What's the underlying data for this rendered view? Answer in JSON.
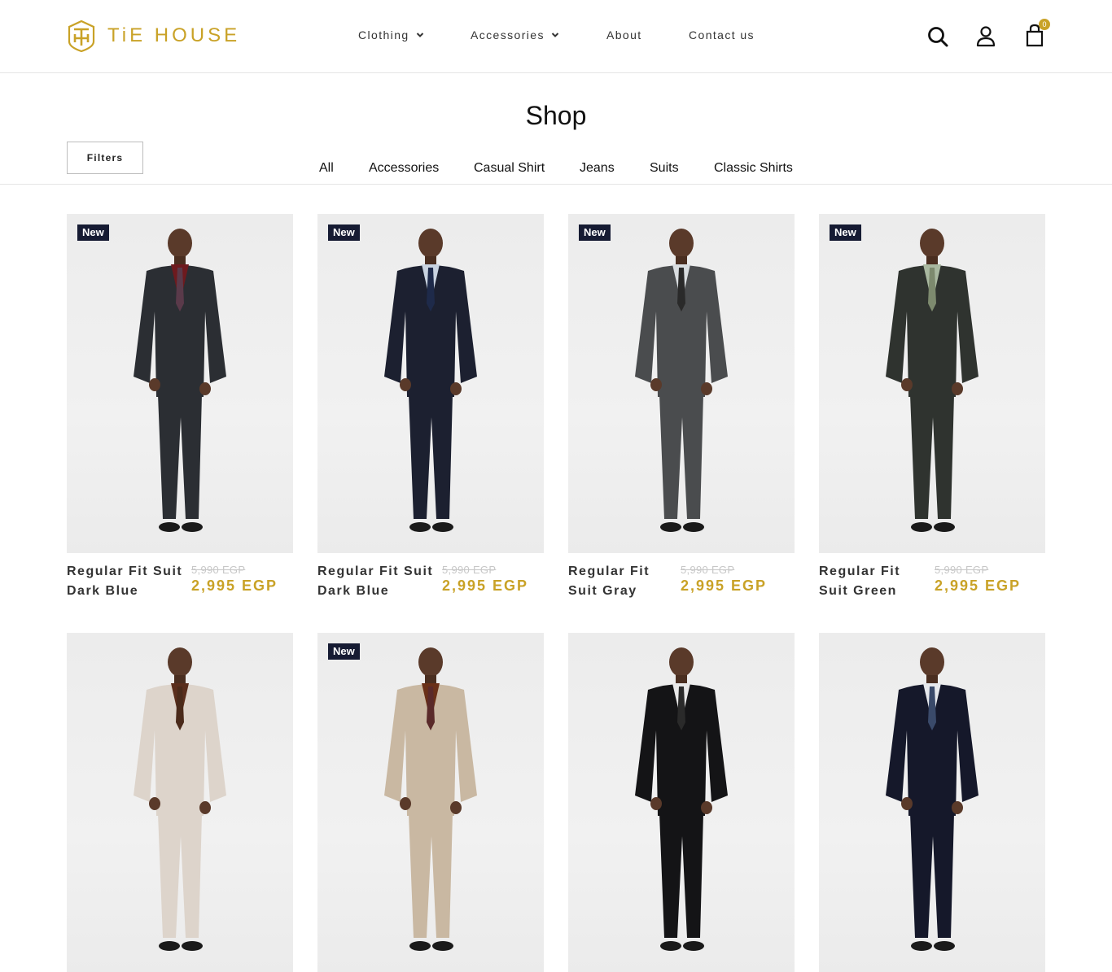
{
  "brand": {
    "name": "TiE HOUSE",
    "accent_color": "#c9a227"
  },
  "nav": {
    "items": [
      {
        "label": "Clothing",
        "has_dropdown": true
      },
      {
        "label": "Accessories",
        "has_dropdown": true
      },
      {
        "label": "About",
        "has_dropdown": false
      },
      {
        "label": "Contact us",
        "has_dropdown": false
      }
    ]
  },
  "header_icons": {
    "search": "search-icon",
    "account": "user-icon",
    "cart": "shopping-bag-icon",
    "cart_count": "0"
  },
  "shop": {
    "title": "Shop",
    "filters_label": "Filters",
    "categories": [
      "All",
      "Accessories",
      "Casual Shirt",
      "Jeans",
      "Suits",
      "Classic Shirts"
    ]
  },
  "products": [
    {
      "badge": "New",
      "name_line1": "Regular Fit Suit",
      "name_line2": "Dark Blue",
      "old_price": "5,990 EGP",
      "price": "2,995 EGP",
      "suit_color": "#2b2e33",
      "shirt_color": "#6e1a1e",
      "tie_color": "#5a3a4a"
    },
    {
      "badge": "New",
      "name_line1": "Regular Fit Suit",
      "name_line2": "Dark Blue",
      "old_price": "5,990 EGP",
      "price": "2,995 EGP",
      "suit_color": "#1c2030",
      "shirt_color": "#c9d3e0",
      "tie_color": "#1e2a4a"
    },
    {
      "badge": "New",
      "name_line1": "Regular Fit",
      "name_line2": "Suit Gray",
      "old_price": "5,990 EGP",
      "price": "2,995 EGP",
      "suit_color": "#4a4c4e",
      "shirt_color": "#d9dde0",
      "tie_color": "#2a2a2a"
    },
    {
      "badge": "New",
      "name_line1": "Regular Fit",
      "name_line2": "Suit Green",
      "old_price": "5,990 EGP",
      "price": "2,995 EGP",
      "suit_color": "#2f332f",
      "shirt_color": "#a9b8a0",
      "tie_color": "#7d8a6e"
    },
    {
      "badge": "",
      "name_line1": "",
      "name_line2": "",
      "old_price": "",
      "price": "",
      "suit_color": "#ddd4cb",
      "shirt_color": "#5a2e1c",
      "tie_color": "#4a2a1a"
    },
    {
      "badge": "New",
      "name_line1": "",
      "name_line2": "",
      "old_price": "",
      "price": "",
      "suit_color": "#c9b8a2",
      "shirt_color": "#6a3018",
      "tie_color": "#5a2a2a"
    },
    {
      "badge": "",
      "name_line1": "",
      "name_line2": "",
      "old_price": "",
      "price": "",
      "suit_color": "#141416",
      "shirt_color": "#e8e8e8",
      "tie_color": "#2a2a2a"
    },
    {
      "badge": "",
      "name_line1": "",
      "name_line2": "",
      "old_price": "",
      "price": "",
      "suit_color": "#15182a",
      "shirt_color": "#e6e8ec",
      "tie_color": "#3a4a6a"
    }
  ]
}
